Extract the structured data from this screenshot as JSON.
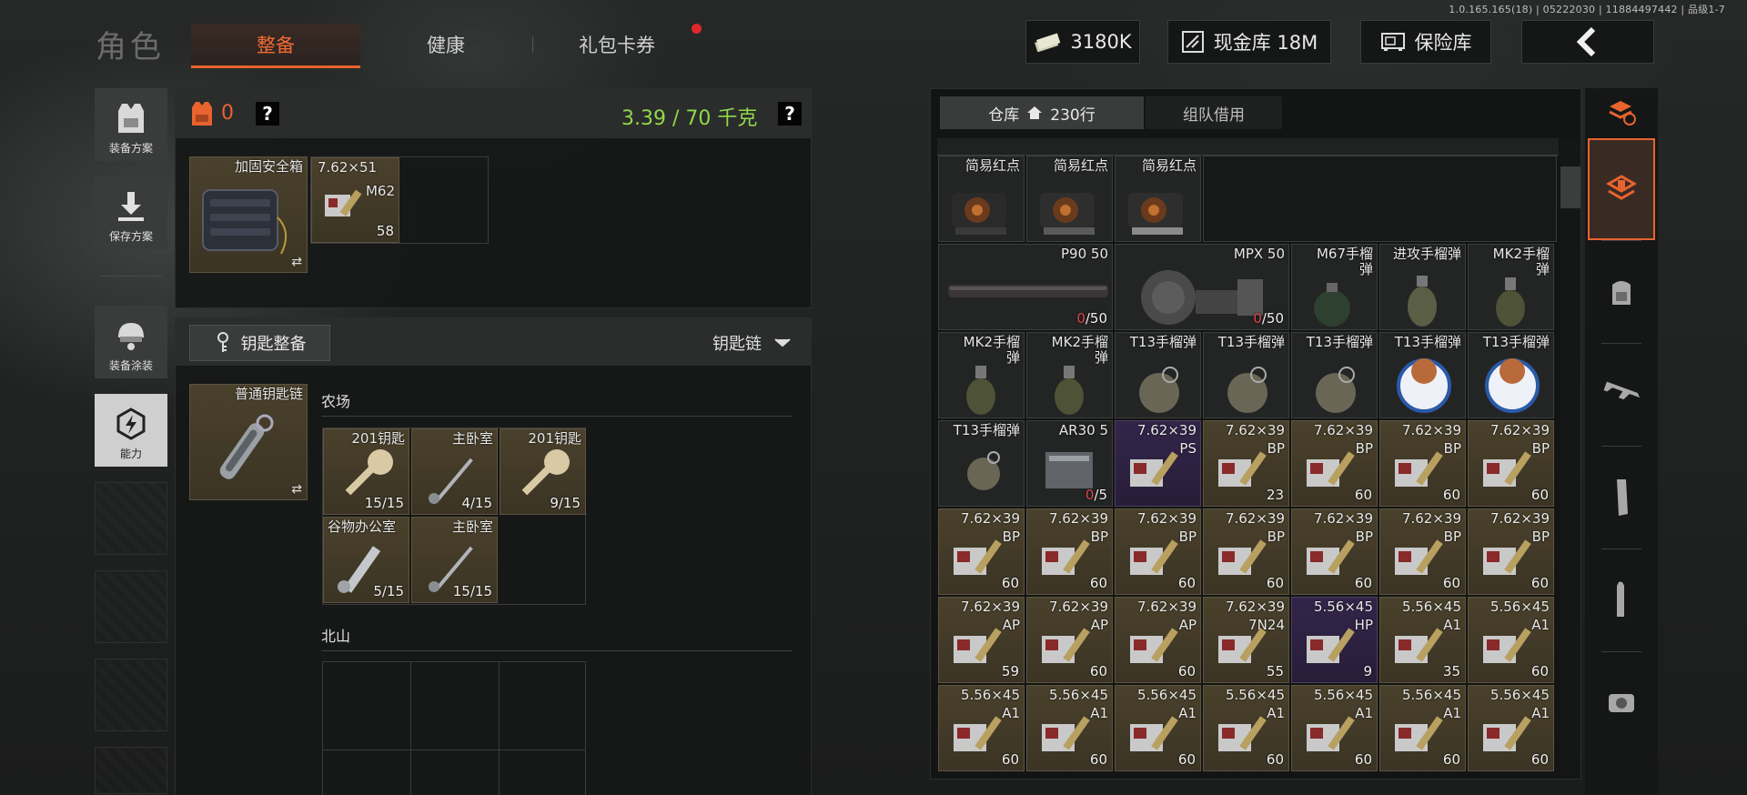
{
  "version": "1.0.165.165(18) | 05222030 | 11884497442 | 品级1-7",
  "header": {
    "title": "角色",
    "tabs": [
      {
        "label": "整备",
        "active": true
      },
      {
        "label": "健康",
        "active": false
      },
      {
        "label": "礼包卡券",
        "active": false,
        "badge": true
      }
    ],
    "currency": "3180K",
    "cash_vault": "现金库 18M",
    "safe": "保险库"
  },
  "left_sidebar": {
    "items": [
      {
        "label": "装备方案",
        "icon": "vest-icon"
      },
      {
        "label": "保存方案",
        "icon": "download-icon"
      },
      {
        "label": "装备涂装",
        "icon": "helmet-icon"
      },
      {
        "label": "能力",
        "icon": "lightning-icon"
      }
    ]
  },
  "loadout": {
    "armor_value": "0",
    "help": "?",
    "weight": "3.39 / 70 千克",
    "secure_case": {
      "name": "加固安全箱"
    },
    "secure_items": [
      {
        "name": "7.62×51",
        "sub": "M62",
        "count": "58"
      }
    ],
    "keys_button": "钥匙整备",
    "keychain_dropdown": "钥匙链",
    "keychain": {
      "name": "普通钥匙链"
    },
    "farm_section": "农场",
    "farm_keys": [
      {
        "name": "201钥匙",
        "count": "15/15"
      },
      {
        "name": "主卧室",
        "count": "4/15"
      },
      {
        "name": "201钥匙",
        "count": "9/15"
      },
      {
        "name": "谷物办公室",
        "count": "5/15"
      },
      {
        "name": "主卧室",
        "count": "15/15"
      }
    ],
    "north_section": "北山"
  },
  "warehouse": {
    "tab_label": "仓库",
    "rows": "230行",
    "team_tab": "组队借用",
    "colors": {
      "gold": "#3b3424",
      "purple": "#2a1e3a",
      "accent": "#e8632e",
      "green": "#8fd94a"
    },
    "row1": [
      {
        "name": "简易红点"
      },
      {
        "name": "简易红点"
      },
      {
        "name": "简易红点"
      }
    ],
    "row2": [
      {
        "name": "P90 50",
        "count_zero": "0",
        "count_rest": "/50"
      },
      {
        "name": "MPX 50",
        "count_zero": "0",
        "count_rest": "/50"
      },
      {
        "name": "M67手榴\n弹"
      },
      {
        "name": "进攻手榴弹"
      },
      {
        "name": "MK2手榴\n弹"
      }
    ],
    "row3": [
      {
        "name": "MK2手榴\n弹"
      },
      {
        "name": "MK2手榴\n弹"
      },
      {
        "name": "T13手榴弹"
      },
      {
        "name": "T13手榴弹"
      },
      {
        "name": "T13手榴弹"
      },
      {
        "name": "T13手榴弹"
      },
      {
        "name": "T13手榴弹"
      }
    ],
    "row4": [
      {
        "name": "T13手榴弹",
        "sub": "",
        "count": "",
        "style": "gray"
      },
      {
        "name": "AR30 5",
        "sub": "",
        "count_zero": "0",
        "count_rest": "/5",
        "style": "gray"
      },
      {
        "name": "7.62×39",
        "sub": "PS",
        "count": "",
        "style": "purple"
      },
      {
        "name": "7.62×39",
        "sub": "BP",
        "count": "23",
        "style": "gold"
      },
      {
        "name": "7.62×39",
        "sub": "BP",
        "count": "60",
        "style": "gold"
      },
      {
        "name": "7.62×39",
        "sub": "BP",
        "count": "60",
        "style": "gold"
      },
      {
        "name": "7.62×39",
        "sub": "BP",
        "count": "60",
        "style": "gold"
      }
    ],
    "row5": [
      {
        "name": "7.62×39",
        "sub": "BP",
        "count": "60",
        "style": "gold"
      },
      {
        "name": "7.62×39",
        "sub": "BP",
        "count": "60",
        "style": "gold"
      },
      {
        "name": "7.62×39",
        "sub": "BP",
        "count": "60",
        "style": "gold"
      },
      {
        "name": "7.62×39",
        "sub": "BP",
        "count": "60",
        "style": "gold"
      },
      {
        "name": "7.62×39",
        "sub": "BP",
        "count": "60",
        "style": "gold"
      },
      {
        "name": "7.62×39",
        "sub": "BP",
        "count": "60",
        "style": "gold"
      },
      {
        "name": "7.62×39",
        "sub": "BP",
        "count": "60",
        "style": "gold"
      }
    ],
    "row6": [
      {
        "name": "7.62×39",
        "sub": "AP",
        "count": "59",
        "style": "gold"
      },
      {
        "name": "7.62×39",
        "sub": "AP",
        "count": "60",
        "style": "gold"
      },
      {
        "name": "7.62×39",
        "sub": "AP",
        "count": "60",
        "style": "gold"
      },
      {
        "name": "7.62×39",
        "sub": "7N24",
        "count": "55",
        "style": "gold"
      },
      {
        "name": "5.56×45",
        "sub": "HP",
        "count": "9",
        "style": "purple"
      },
      {
        "name": "5.56×45",
        "sub": "A1",
        "count": "35",
        "style": "gold"
      },
      {
        "name": "5.56×45",
        "sub": "A1",
        "count": "60",
        "style": "gold"
      }
    ],
    "row7": [
      {
        "name": "5.56×45",
        "sub": "A1",
        "count": "60",
        "style": "gold"
      },
      {
        "name": "5.56×45",
        "sub": "A1",
        "count": "60",
        "style": "gold"
      },
      {
        "name": "5.56×45",
        "sub": "A1",
        "count": "60",
        "style": "gold"
      },
      {
        "name": "5.56×45",
        "sub": "A1",
        "count": "60",
        "style": "gold"
      },
      {
        "name": "5.56×45",
        "sub": "A1",
        "count": "60",
        "style": "gold"
      },
      {
        "name": "5.56×45",
        "sub": "A1",
        "count": "60",
        "style": "gold"
      },
      {
        "name": "5.56×45",
        "sub": "A1",
        "count": "60",
        "style": "gold"
      }
    ]
  },
  "right_sidebar": {
    "icons": [
      "sort-icon",
      "all-items-icon",
      "backpack-icon",
      "rifle-icon",
      "magazine-icon",
      "ammo-icon",
      "scope-icon"
    ]
  }
}
